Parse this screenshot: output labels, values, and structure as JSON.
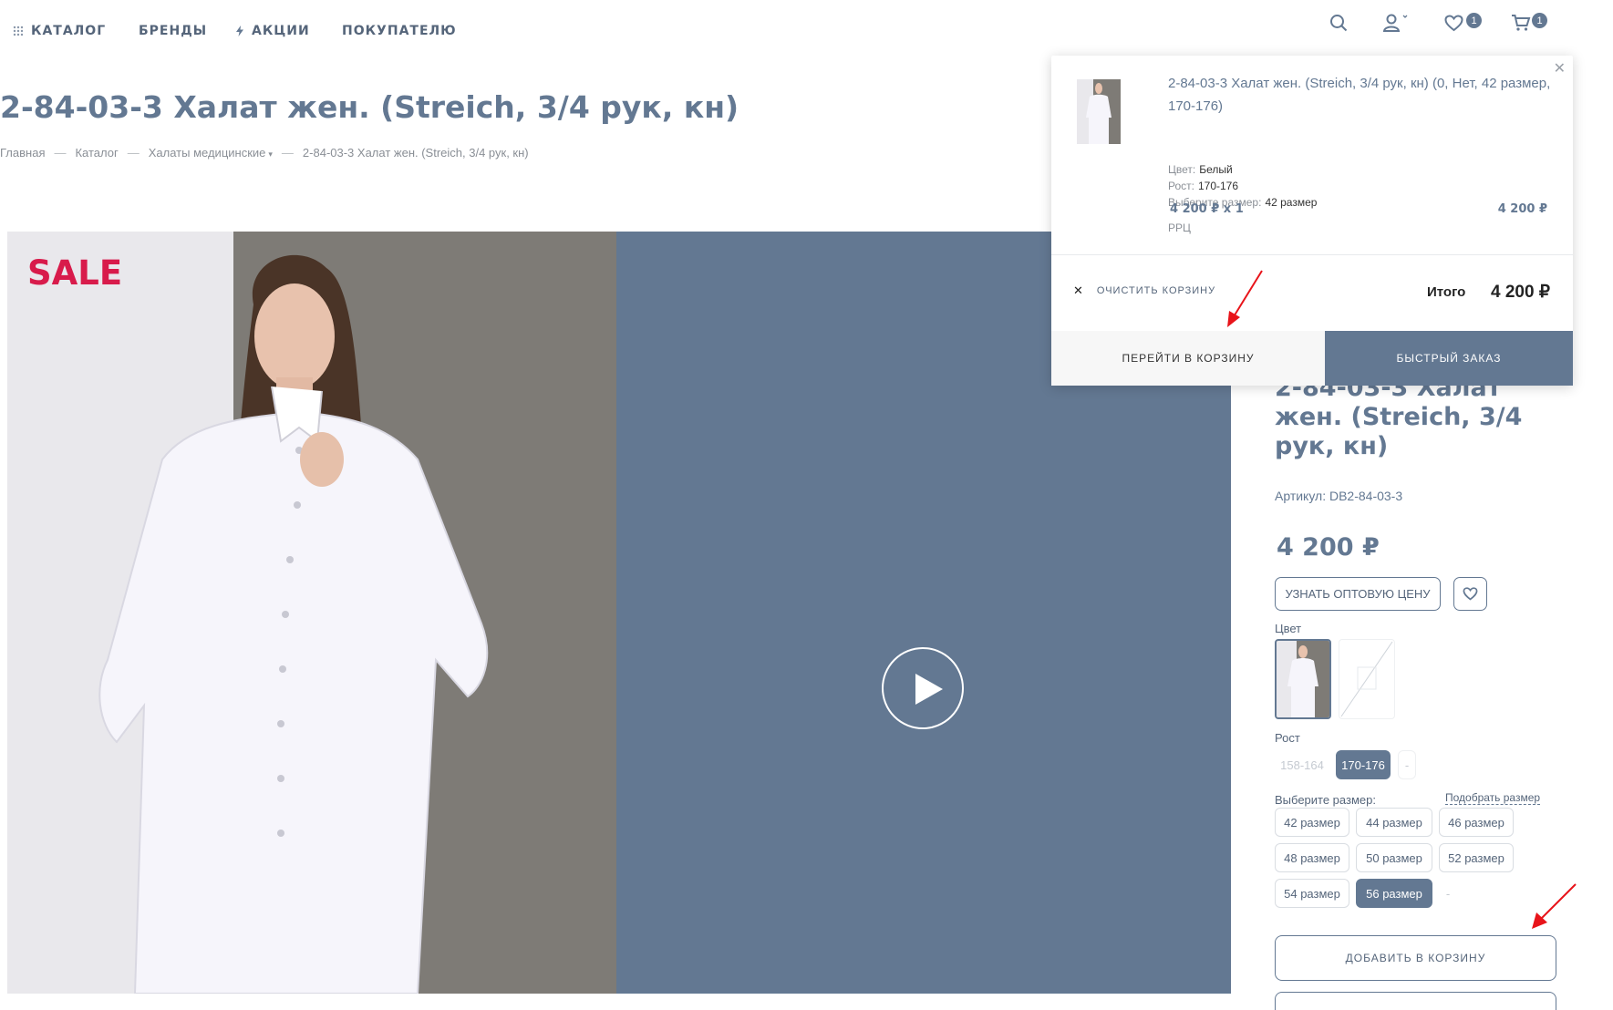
{
  "nav": {
    "catalog": "КАТАЛОГ",
    "brands": "БРЕНДЫ",
    "sales": "АКЦИИ",
    "buyer": "ПОКУПАТЕЛЮ",
    "favorites_count": "1",
    "cart_count": "1"
  },
  "page": {
    "title": "2-84-03-3 Халат жен. (Streich, 3/4 рук, кн)",
    "breadcrumbs": [
      "Главная",
      "Каталог",
      "Халаты медицинские",
      "2-84-03-3 Халат жен. (Streich, 3/4 рук, кн)"
    ]
  },
  "gallery": {
    "badge": "SALE"
  },
  "product": {
    "title": "2-84-03-3 Халат жен. (Streich, 3/4 рук, кн)",
    "sku": "Артикул: DB2-84-03-3",
    "price": "4 200 ₽",
    "wholesale_button": "УЗНАТЬ ОПТОВУЮ ЦЕНУ",
    "color_label": "Цвет",
    "height_label": "Рост",
    "heights": [
      {
        "label": "158-164",
        "state": "disabled"
      },
      {
        "label": "170-176",
        "state": "selected"
      },
      {
        "label": "-",
        "state": "disabled"
      }
    ],
    "size_label": "Выберите размер:",
    "size_link": "Подобрать размер",
    "sizes": [
      {
        "label": "42 размер",
        "state": "normal"
      },
      {
        "label": "44 размер",
        "state": "normal"
      },
      {
        "label": "46 размер",
        "state": "normal"
      },
      {
        "label": "48 размер",
        "state": "normal"
      },
      {
        "label": "50 размер",
        "state": "normal"
      },
      {
        "label": "52 размер",
        "state": "normal"
      },
      {
        "label": "54 размер",
        "state": "normal"
      },
      {
        "label": "56 размер",
        "state": "selected"
      },
      {
        "label": "-",
        "state": "disabled"
      }
    ],
    "add_to_cart": "ДОБАВИТЬ В КОРЗИНУ"
  },
  "cart_popup": {
    "item_name": "2-84-03-3 Халат жен. (Streich, 3/4 рук, кн) (0, Нет, 42 размер, 170-176)",
    "color_label": "Цвет:",
    "color_value": "Белый",
    "height_label": "Рост:",
    "height_value": "170-176",
    "size_label": "Выберите размер:",
    "size_value": "42 размер",
    "qty_price": "4 200 ₽ x 1",
    "rrc": "РРЦ",
    "line_total": "4 200 ₽",
    "clear_cart": "ОЧИСТИТЬ КОРЗИНУ",
    "total_label": "Итого",
    "total_value": "4 200 ₽",
    "go_to_cart": "ПЕРЕЙТИ В КОРЗИНУ",
    "quick_order": "БЫСТРЫЙ ЗАКАЗ"
  },
  "colors": {
    "accent": "#637892",
    "sale": "#d81b4b",
    "annotation_arrow": "#e8141a"
  }
}
